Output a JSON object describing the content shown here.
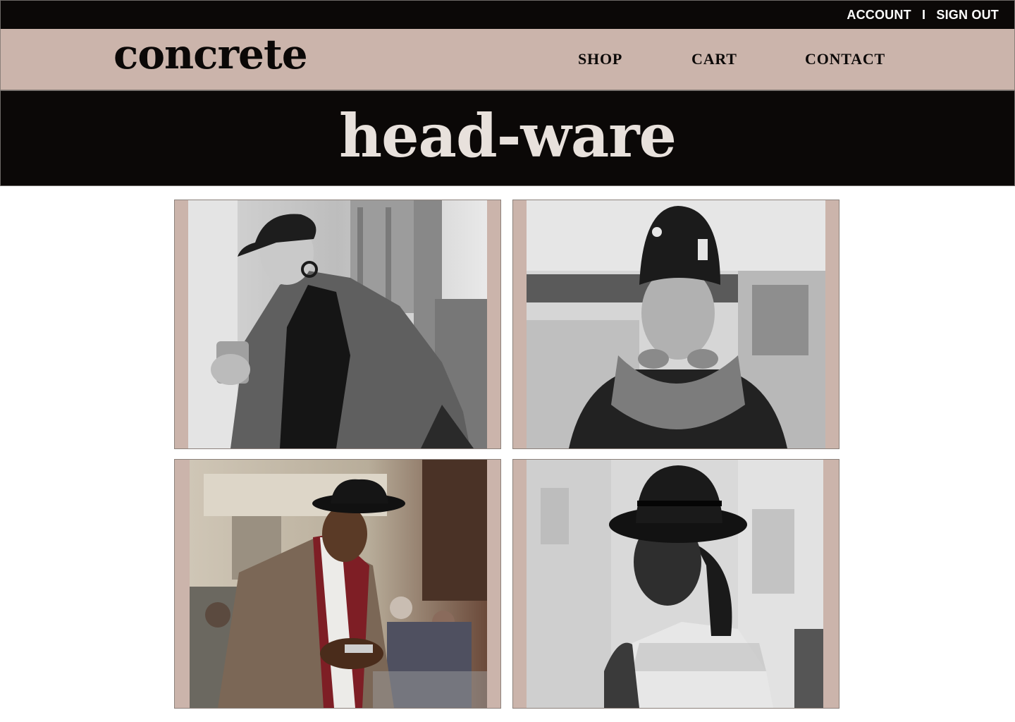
{
  "topbar": {
    "account_label": "ACCOUNT",
    "separator": "I",
    "signout_label": "SIGN OUT"
  },
  "header": {
    "logo": "concrete",
    "nav": [
      "SHOP",
      "CART",
      "CONTACT"
    ]
  },
  "banner": {
    "title": "head-ware"
  },
  "gallery": {
    "items": [
      {
        "subject": "woman-in-cap-with-coffee",
        "tone": "grayscale"
      },
      {
        "subject": "young-man-in-baseball-cap-with-scarf",
        "tone": "grayscale"
      },
      {
        "subject": "man-in-fedora-looking-at-phone",
        "tone": "color"
      },
      {
        "subject": "woman-in-wide-brim-hat",
        "tone": "grayscale"
      }
    ]
  },
  "colors": {
    "dark": "#0b0807",
    "accent": "#cbb4ab",
    "banner_text": "#e8e1dc"
  }
}
